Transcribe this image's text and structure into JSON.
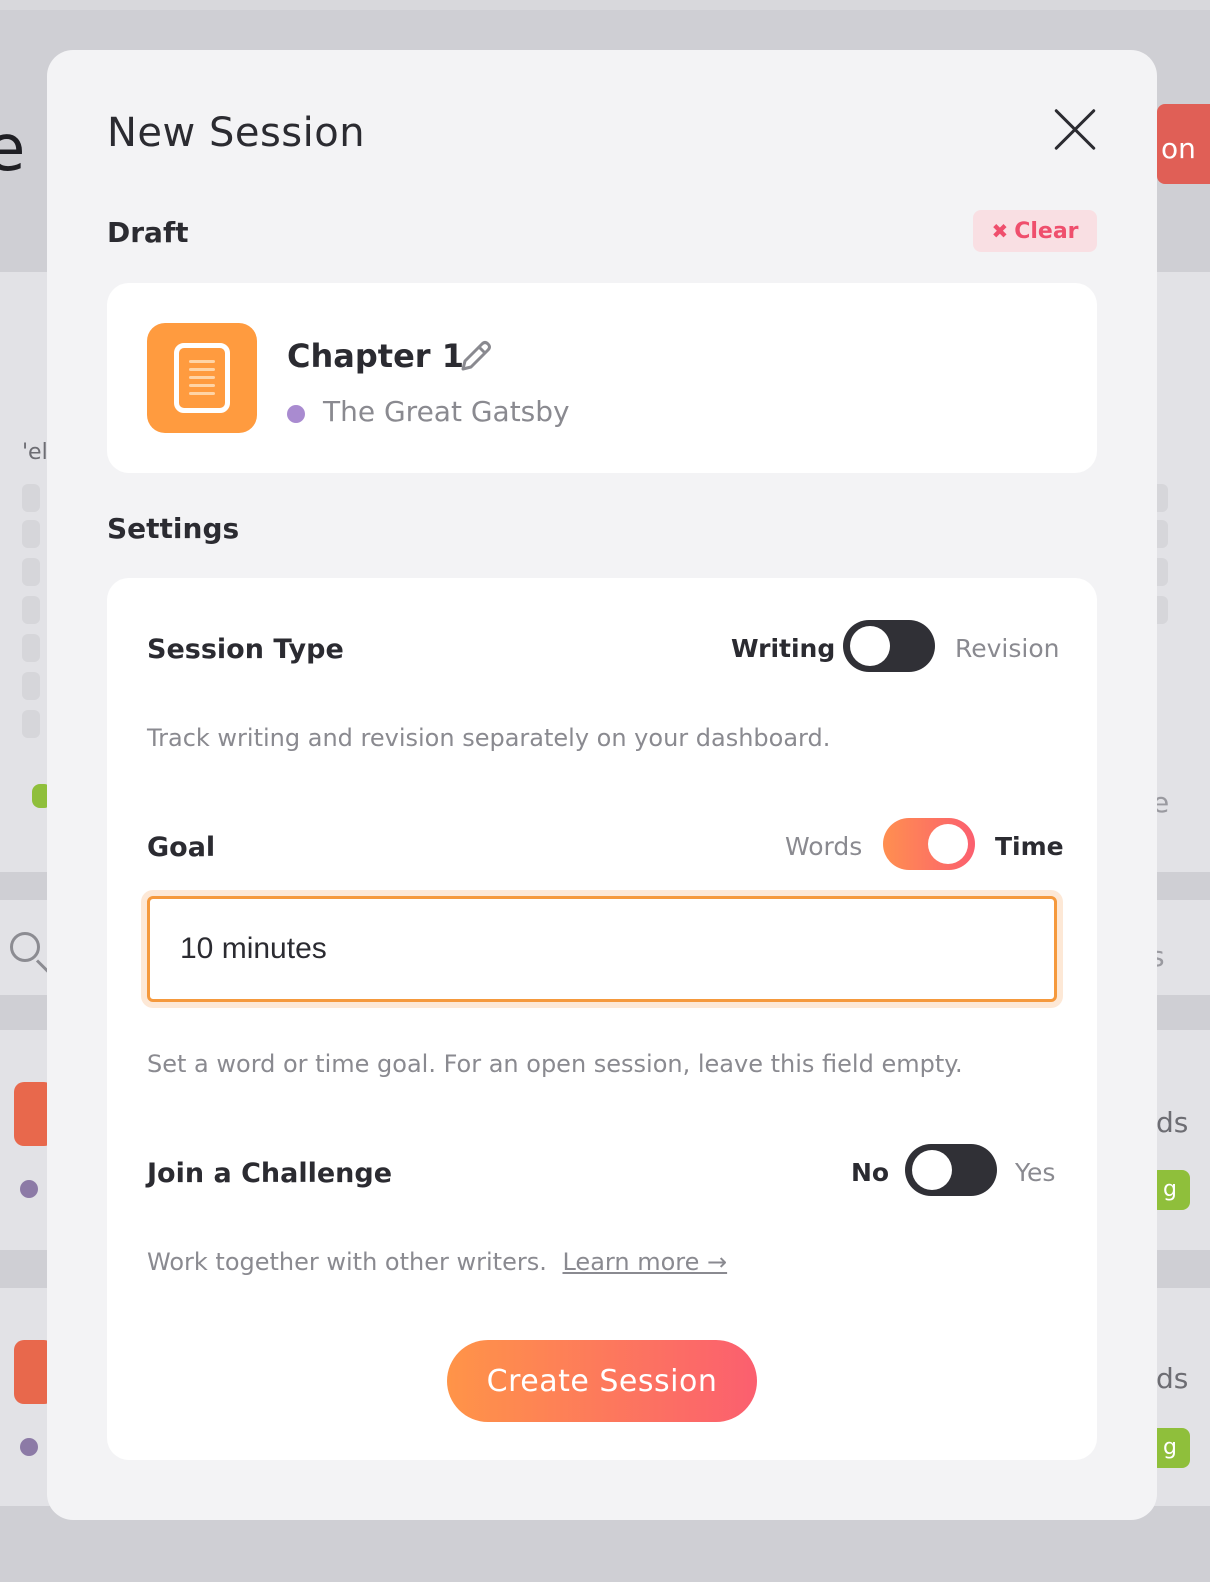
{
  "modal": {
    "title": "New Session",
    "draft_section_label": "Draft",
    "clear_label": "Clear",
    "clear_icon": "✖",
    "draft": {
      "title": "Chapter 1",
      "project": "The Great Gatsby",
      "icon": "document-icon",
      "icon_color": "#ff9b3f",
      "project_color": "#a98bd0"
    },
    "settings_section_label": "Settings",
    "session_type": {
      "label": "Session Type",
      "option_left": "Writing",
      "option_right": "Revision",
      "selected": "Writing",
      "helper": "Track writing and revision separately on your dashboard."
    },
    "goal": {
      "label": "Goal",
      "option_left": "Words",
      "option_right": "Time",
      "selected": "Time",
      "input_value": "10 minutes",
      "helper": "Set a word or time goal. For an open session, leave this field empty."
    },
    "challenge": {
      "label": "Join a Challenge",
      "option_left": "No",
      "option_right": "Yes",
      "selected": "No",
      "helper": "Work together with other writers.",
      "learn_more": "Learn more →"
    },
    "create_button": "Create Session"
  },
  "background": {
    "title_fragment": "e",
    "button_fragment": "on",
    "side_fragment": "'el",
    "right_fragment_1": "e",
    "right_fragment_2": "s",
    "right_fragment_3": "ds",
    "right_fragment_4": "ds",
    "badge_fragment": "g"
  },
  "colors": {
    "accent_orange": "#f5993d",
    "accent_pink": "#fb5f6f",
    "clear_red": "#ef4f6d"
  }
}
